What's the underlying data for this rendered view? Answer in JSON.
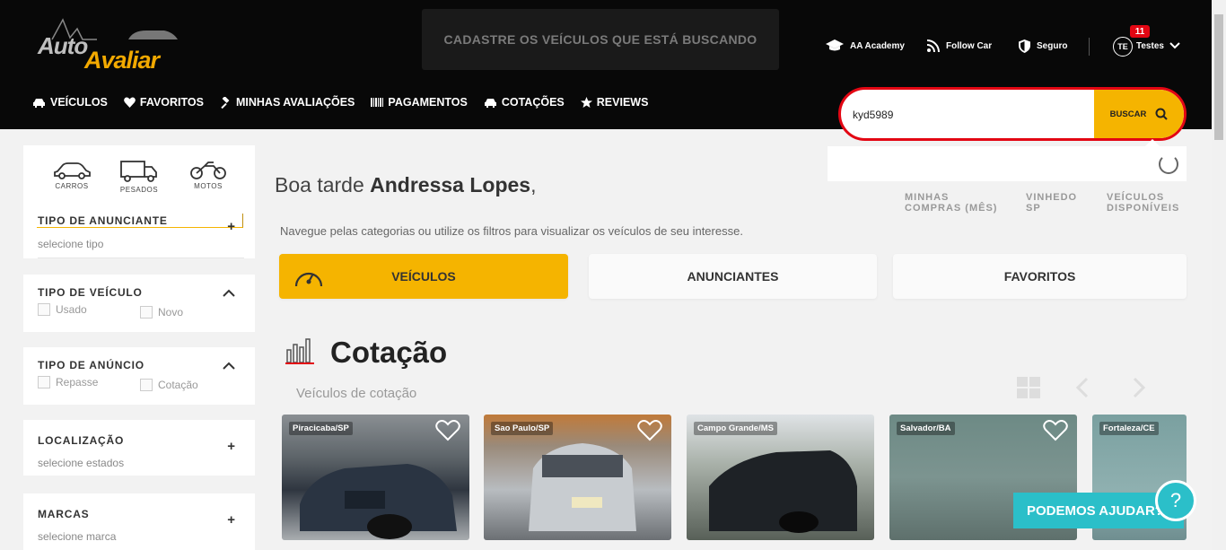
{
  "header": {
    "logo_auto": "Auto",
    "logo_avaliar": "Avaliar",
    "cadastre_banner": "CADASTRE OS VEÍCULOS QUE ESTÁ BUSCANDO",
    "links": [
      {
        "label": "AA Academy",
        "icon": "graduation-cap-icon"
      },
      {
        "label": "Follow Car",
        "icon": "rss-icon"
      },
      {
        "label": "Seguro",
        "icon": "shield-icon"
      }
    ],
    "user": {
      "initials": "TE",
      "name": "Testes",
      "notifications": "11"
    }
  },
  "nav": [
    {
      "label": "VEÍCULOS",
      "icon": "car-icon"
    },
    {
      "label": "FAVORITOS",
      "icon": "heart-icon"
    },
    {
      "label": "MINHAS AVALIAÇÕES",
      "icon": "gavel-icon"
    },
    {
      "label": "PAGAMENTOS",
      "icon": "barcode-icon"
    },
    {
      "label": "COTAÇÕES",
      "icon": "car-icon"
    },
    {
      "label": "REVIEWS",
      "icon": "star-icon"
    }
  ],
  "search": {
    "value": "kyd5989",
    "button_label": "BUSCAR"
  },
  "sidebar": {
    "categories": [
      {
        "label": "CARROS",
        "icon": "car-icon"
      },
      {
        "label": "PESADOS",
        "icon": "truck-icon"
      },
      {
        "label": "MOTOS",
        "icon": "motorcycle-icon"
      }
    ],
    "filters": {
      "tipo_anunciante": {
        "title": "TIPO DE ANUNCIANTE",
        "placeholder": "selecione tipo"
      },
      "tipo_veiculo": {
        "title": "TIPO DE VEÍCULO",
        "options": [
          "Usado",
          "Novo"
        ]
      },
      "tipo_anuncio": {
        "title": "TIPO DE ANÚNCIO",
        "options": [
          "Repasse",
          "Cotação"
        ]
      },
      "localizacao": {
        "title": "LOCALIZAÇÃO",
        "placeholder": "selecione estados"
      },
      "marcas": {
        "title": "MARCAS",
        "placeholder": "selecione marca"
      }
    }
  },
  "main": {
    "greeting_prefix": "Boa tarde",
    "user_name": "Andressa Lopes",
    "greeting_suffix": ",",
    "stats": [
      {
        "line1": "MINHAS",
        "line2": "COMPRAS (MÊS)"
      },
      {
        "line1": "VINHEDO",
        "line2": "SP"
      },
      {
        "line1": "VEÍCULOS",
        "line2": "DISPONÍVEIS"
      }
    ],
    "intro": "Navegue pelas categorias ou utilize os filtros para visualizar os veículos de seu interesse.",
    "tabs": [
      {
        "label": "VEÍCULOS",
        "active": true
      },
      {
        "label": "ANUNCIANTES",
        "active": false
      },
      {
        "label": "FAVORITOS",
        "active": false
      }
    ],
    "section_title": "Cotação",
    "section_subtitle": "Veículos de cotação",
    "cards": [
      {
        "location": "Piracicaba/SP"
      },
      {
        "location": "Sao Paulo/SP"
      },
      {
        "location": "Campo Grande/MS"
      },
      {
        "location": "Salvador/BA"
      },
      {
        "location": "Fortaleza/CE"
      }
    ]
  },
  "help": {
    "label": "PODEMOS AJUDAR?",
    "icon_text": "?"
  },
  "colors": {
    "accent": "#f5b400",
    "search_border": "#e30613",
    "help": "#2bbfc9",
    "header_bg": "#080808"
  }
}
